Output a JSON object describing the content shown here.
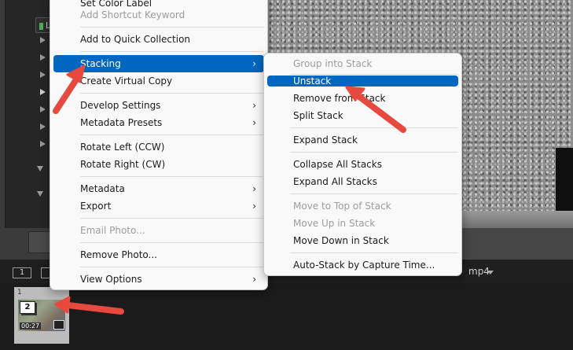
{
  "main_menu": {
    "items": [
      {
        "label": "Set Color Label",
        "disabled": false,
        "submenu": true
      },
      {
        "label": "Add Shortcut Keyword",
        "disabled": true
      },
      {
        "label": "Add to Quick Collection"
      },
      {
        "label": "Stacking",
        "highlighted": true,
        "submenu": true
      },
      {
        "label": "Create Virtual Copy"
      },
      {
        "label": "Develop Settings",
        "submenu": true
      },
      {
        "label": "Metadata Presets",
        "submenu": true
      },
      {
        "label": "Rotate Left (CCW)"
      },
      {
        "label": "Rotate Right (CW)"
      },
      {
        "label": "Metadata",
        "submenu": true
      },
      {
        "label": "Export",
        "submenu": true
      },
      {
        "label": "Email Photo...",
        "disabled": true
      },
      {
        "label": "Remove Photo..."
      },
      {
        "label": "View Options",
        "submenu": true
      }
    ]
  },
  "stacking_submenu": {
    "items": [
      {
        "label": "Group into Stack",
        "disabled": true
      },
      {
        "label": "Unstack",
        "highlighted": true
      },
      {
        "label": "Remove from Stack"
      },
      {
        "label": "Split Stack"
      },
      {
        "label": "Expand Stack"
      },
      {
        "label": "Collapse All Stacks"
      },
      {
        "label": "Expand All Stacks"
      },
      {
        "label": "Move to Top of Stack",
        "disabled": true
      },
      {
        "label": "Move Up in Stack",
        "disabled": true
      },
      {
        "label": "Move Down in Stack"
      },
      {
        "label": "Auto-Stack by Capture Time..."
      }
    ]
  },
  "left_panel": {
    "badge_label": "L"
  },
  "filmstrip": {
    "monitor_1": "1",
    "filename_suffix": "mp4",
    "thumb": {
      "index": "1",
      "stack_count": "2",
      "duration": "00:27"
    }
  },
  "colors": {
    "highlight": "#0067c0",
    "annotation_arrow": "#e8493f"
  },
  "icons": [
    "chevron-right-icon",
    "disclosure-triangle-icon",
    "video-icon",
    "stack-badge-icon",
    "dropdown-arrow-icon"
  ]
}
